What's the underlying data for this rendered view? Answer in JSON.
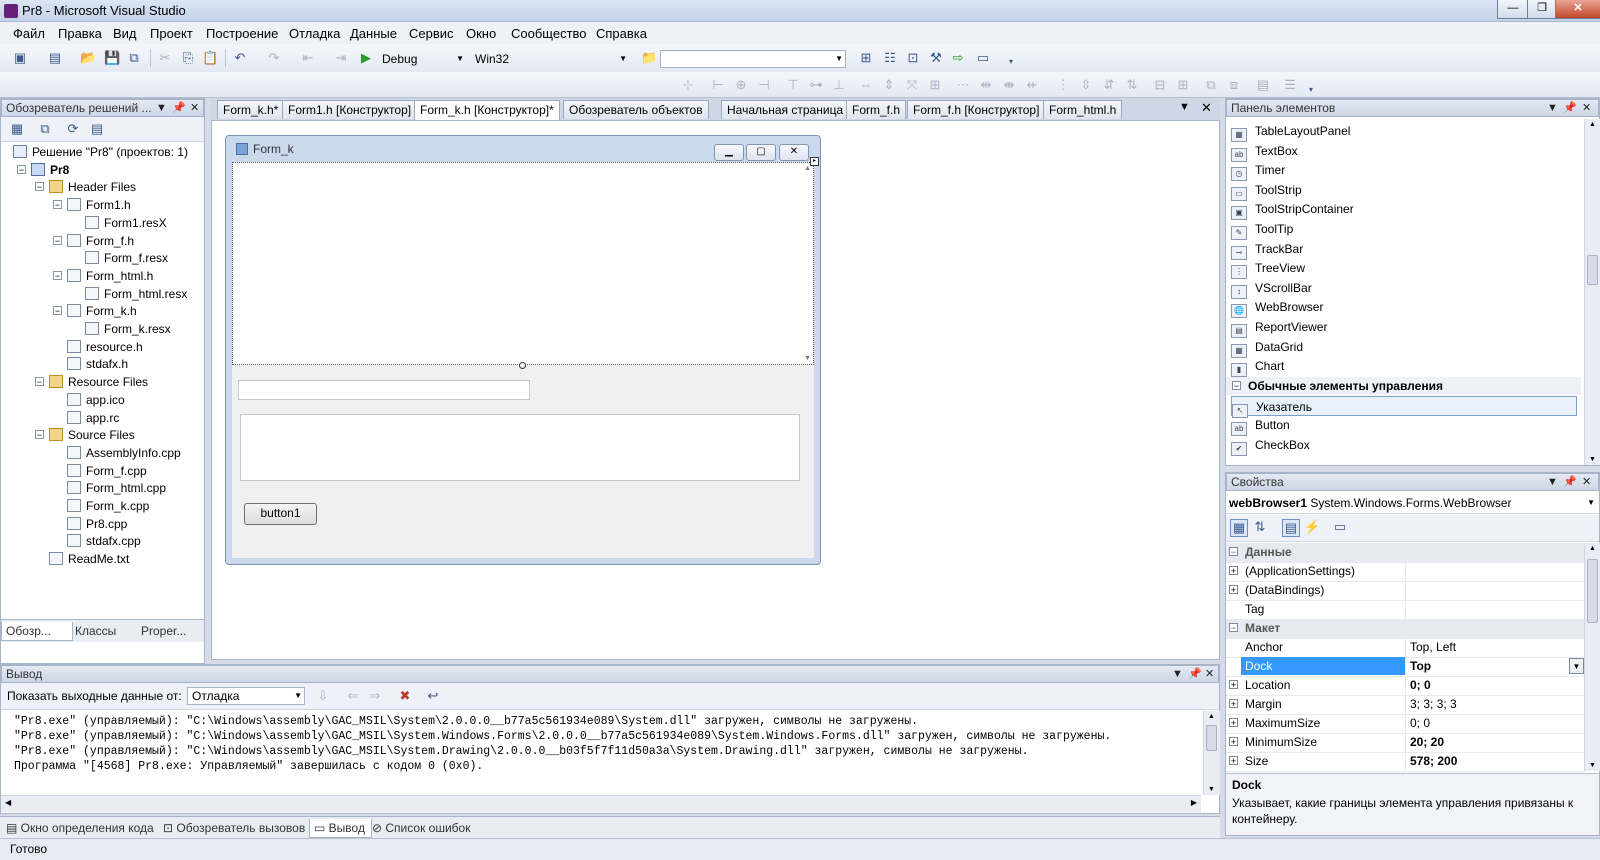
{
  "window": {
    "title": "Pr8 - Microsoft Visual Studio"
  },
  "menu": [
    "Файл",
    "Правка",
    "Вид",
    "Проект",
    "Построение",
    "Отладка",
    "Данные",
    "Сервис",
    "Окно",
    "Сообщество",
    "Справка"
  ],
  "toolbar": {
    "config": "Debug",
    "platform": "Win32"
  },
  "solution_explorer": {
    "title": "Обозреватель решений ...",
    "items": [
      {
        "label": "Решение \"Pr8\"  (проектов: 1)",
        "kind": "sol"
      },
      {
        "label": "Pr8",
        "kind": "proj"
      },
      {
        "label": "Header Files",
        "kind": "folder"
      },
      {
        "label": "Form1.h",
        "kind": "file"
      },
      {
        "label": "Form1.resX",
        "kind": "file"
      },
      {
        "label": "Form_f.h",
        "kind": "file"
      },
      {
        "label": "Form_f.resx",
        "kind": "file"
      },
      {
        "label": "Form_html.h",
        "kind": "file"
      },
      {
        "label": "Form_html.resx",
        "kind": "file"
      },
      {
        "label": "Form_k.h",
        "kind": "file"
      },
      {
        "label": "Form_k.resx",
        "kind": "file"
      },
      {
        "label": "resource.h",
        "kind": "file"
      },
      {
        "label": "stdafx.h",
        "kind": "file"
      },
      {
        "label": "Resource Files",
        "kind": "folder"
      },
      {
        "label": "app.ico",
        "kind": "file"
      },
      {
        "label": "app.rc",
        "kind": "file"
      },
      {
        "label": "Source Files",
        "kind": "folder"
      },
      {
        "label": "AssemblyInfo.cpp",
        "kind": "file"
      },
      {
        "label": "Form_f.cpp",
        "kind": "file"
      },
      {
        "label": "Form_html.cpp",
        "kind": "file"
      },
      {
        "label": "Form_k.cpp",
        "kind": "file"
      },
      {
        "label": "Pr8.cpp",
        "kind": "file"
      },
      {
        "label": "stdafx.cpp",
        "kind": "file"
      },
      {
        "label": "ReadMe.txt",
        "kind": "file"
      }
    ],
    "tabs": [
      "Обозр...",
      "Классы",
      "Proper..."
    ]
  },
  "doc_tabs": [
    "Form_k.h*",
    "Form1.h [Конструктор]",
    "Form_k.h [Конструктор]*",
    "Обозреватель объектов",
    "Начальная страница",
    "Form_f.h",
    "Form_f.h [Конструктор]",
    "Form_html.h"
  ],
  "designer": {
    "form_title": "Form_k",
    "button_label": "button1"
  },
  "toolbox": {
    "title": "Панель элементов",
    "items": [
      "TableLayoutPanel",
      "TextBox",
      "Timer",
      "ToolStrip",
      "ToolStripContainer",
      "ToolTip",
      "TrackBar",
      "TreeView",
      "VScrollBar",
      "WebBrowser",
      "ReportViewer",
      "DataGrid",
      "Chart"
    ],
    "group": "Обычные элементы управления",
    "group_items": [
      "Указатель",
      "Button",
      "CheckBox"
    ]
  },
  "properties": {
    "title": "Свойства",
    "object_name": "webBrowser1",
    "object_type": "System.Windows.Forms.WebBrowser",
    "rows": [
      {
        "name": "Данные",
        "value": "",
        "cat": true
      },
      {
        "name": "(ApplicationSettings)",
        "value": "",
        "exp": true
      },
      {
        "name": "(DataBindings)",
        "value": "",
        "exp": true
      },
      {
        "name": "Tag",
        "value": ""
      },
      {
        "name": "Макет",
        "value": "",
        "cat": true
      },
      {
        "name": "Anchor",
        "value": "Top, Left"
      },
      {
        "name": "Dock",
        "value": "Top",
        "sel": true,
        "bold": true
      },
      {
        "name": "Location",
        "value": "0; 0",
        "exp": true,
        "bold": true
      },
      {
        "name": "Margin",
        "value": "3; 3; 3; 3",
        "exp": true
      },
      {
        "name": "MaximumSize",
        "value": "0; 0",
        "exp": true
      },
      {
        "name": "MinimumSize",
        "value": "20; 20",
        "exp": true,
        "bold": true
      },
      {
        "name": "Size",
        "value": "578; 200",
        "exp": true,
        "bold": true
      }
    ],
    "desc_title": "Dock",
    "desc_text": "Указывает, какие границы элемента управления привязаны к контейнеру."
  },
  "output": {
    "title": "Вывод",
    "show_label": "Показать выходные данные от:",
    "source": "Отладка",
    "lines": [
      "\"Pr8.exe\" (управляемый): \"C:\\Windows\\assembly\\GAC_MSIL\\System\\2.0.0.0__b77a5c561934e089\\System.dll\" загружен, символы не загружены.",
      "\"Pr8.exe\" (управляемый): \"C:\\Windows\\assembly\\GAC_MSIL\\System.Windows.Forms\\2.0.0.0__b77a5c561934e089\\System.Windows.Forms.dll\" загружен, символы не загружены.",
      "\"Pr8.exe\" (управляемый): \"C:\\Windows\\assembly\\GAC_MSIL\\System.Drawing\\2.0.0.0__b03f5f7f11d50a3a\\System.Drawing.dll\" загружен, символы не загружены.",
      "Программа \"[4568] Pr8.exe: Управляемый\" завершилась с кодом 0 (0x0)."
    ],
    "tabs": [
      "Окно определения кода",
      "Обозреватель вызовов",
      "Вывод",
      "Список ошибок"
    ]
  },
  "status": "Готово"
}
